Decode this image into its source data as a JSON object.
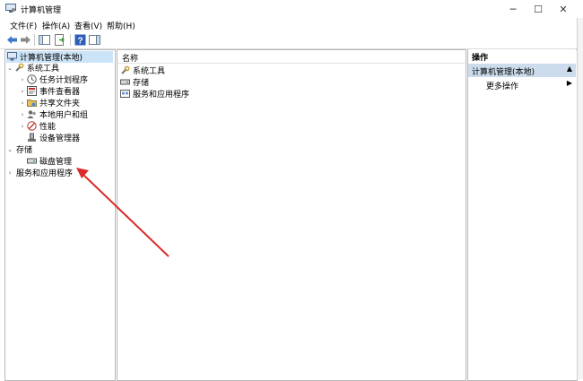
{
  "window": {
    "title": "计算机管理",
    "minimize_glyph": "─",
    "maximize_glyph": "☐",
    "close_glyph": "✕"
  },
  "menu": [
    "文件(F)",
    "操作(A)",
    "查看(V)",
    "帮助(H)"
  ],
  "tree": {
    "root": "计算机管理(本地)",
    "system_tools": "系统工具",
    "task_scheduler": "任务计划程序",
    "event_viewer": "事件查看器",
    "shared_folders": "共享文件夹",
    "local_users": "本地用户和组",
    "performance": "性能",
    "device_manager": "设备管理器",
    "storage": "存储",
    "disk_management": "磁盘管理",
    "services_apps": "服务和应用程序"
  },
  "center": {
    "column_header": "名称",
    "items": [
      "系统工具",
      "存储",
      "服务和应用程序"
    ]
  },
  "actions": {
    "header": "操作",
    "section": "计算机管理(本地)",
    "more": "更多操作"
  },
  "colors": {
    "selection": "#cce4f7",
    "arrow": "#d92b2b"
  }
}
